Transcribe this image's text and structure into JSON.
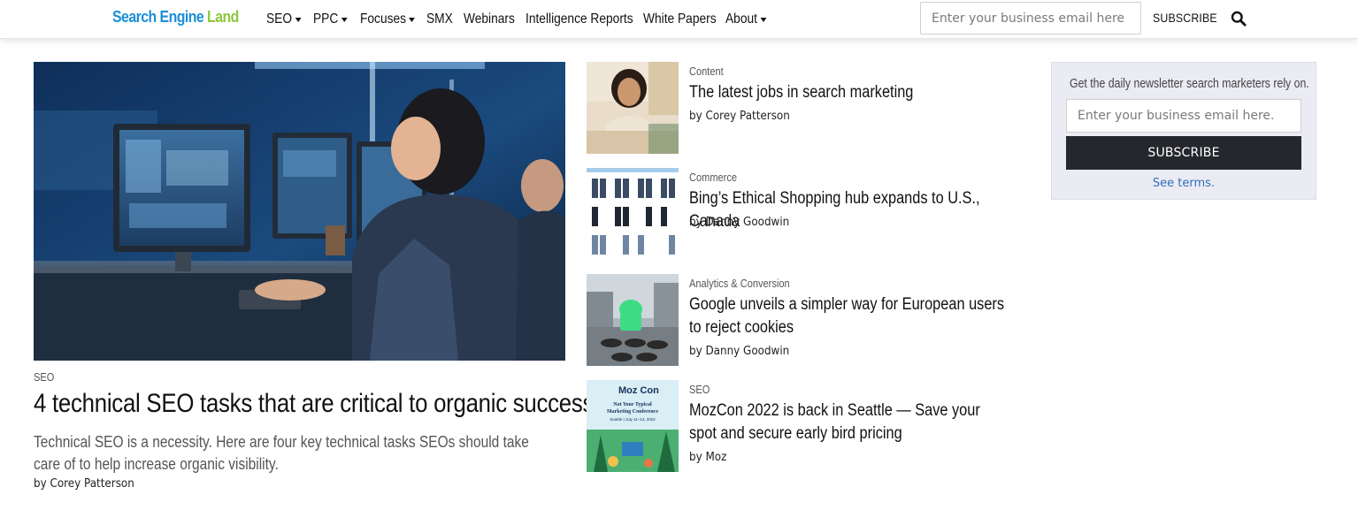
{
  "header": {
    "logo_part1": "Search Engine ",
    "logo_part2": "Land",
    "nav": [
      {
        "label": "SEO",
        "dropdown": true
      },
      {
        "label": "PPC",
        "dropdown": true
      },
      {
        "label": "Focuses",
        "dropdown": true
      },
      {
        "label": "SMX",
        "dropdown": false
      },
      {
        "label": "Webinars",
        "dropdown": false
      },
      {
        "label": "Intelligence Reports",
        "dropdown": false
      },
      {
        "label": "White Papers",
        "dropdown": false
      },
      {
        "label": "About",
        "dropdown": true
      }
    ],
    "email_placeholder": "Enter your business email here",
    "subscribe_label": "SUBSCRIBE",
    "search_icon": "search-icon"
  },
  "hero": {
    "category": "SEO",
    "title": "4 technical SEO tasks that are critical to organic success",
    "description": "Technical SEO is a necessity. Here are four key technical tasks SEOs should take care of to help increase organic visibility.",
    "byline": "by Corey Patterson"
  },
  "articles": [
    {
      "category": "Content",
      "title": "The latest jobs in search marketing",
      "byline": "by Corey Patterson"
    },
    {
      "category": "Commerce",
      "title": "Bing’s Ethical Shopping hub expands to U.S., Canada",
      "byline": "by Danny Goodwin"
    },
    {
      "category": "Analytics & Conversion",
      "title": "Google unveils a simpler way for European users to reject cookies",
      "byline": "by Danny Goodwin"
    },
    {
      "category": "SEO",
      "title": "MozCon 2022 is back in Seattle — Save your spot and secure early bird pricing",
      "byline": "by Moz"
    }
  ],
  "newsletter": {
    "text": "Get the daily newsletter search marketers rely on.",
    "email_placeholder": "Enter your business email here.",
    "subscribe_label": "SUBSCRIBE",
    "terms_label": "See terms."
  },
  "mozcon_thumb": {
    "logo": "Moz Con",
    "tag1": "Not Your Typical",
    "tag2": "Marketing Conference",
    "dates": "Seattle | July 11–13, 2022"
  },
  "colors": {
    "logo_blue": "#1a8fd9",
    "logo_green": "#8cc63f",
    "button_dark": "#25272d",
    "link_blue": "#2f6fb7",
    "newsletter_bg": "#ebebf4"
  }
}
